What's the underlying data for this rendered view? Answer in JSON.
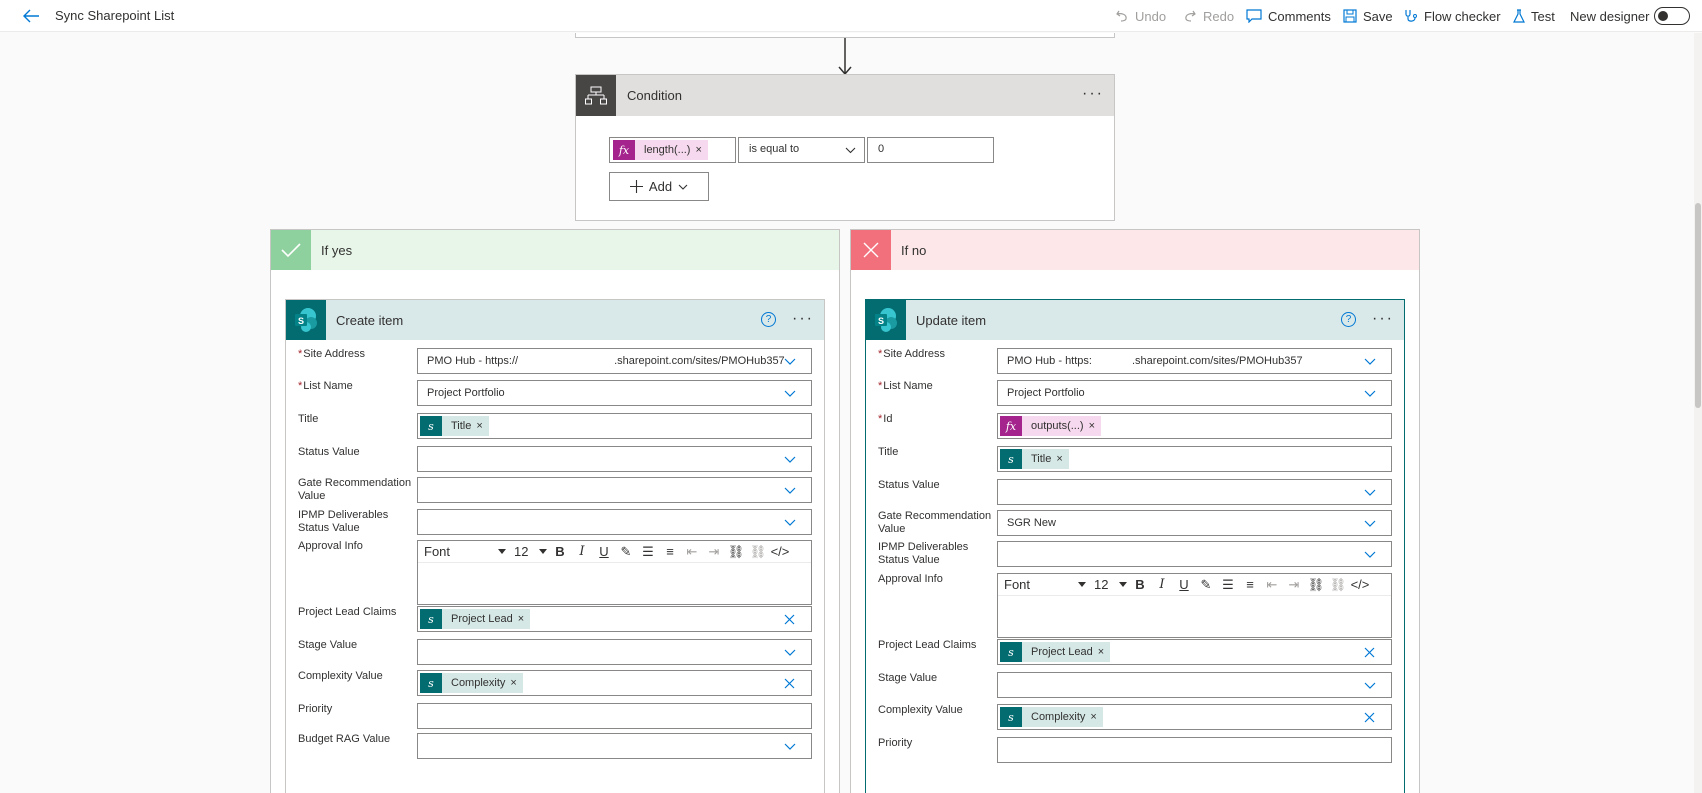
{
  "header": {
    "title": "Sync Sharepoint List",
    "commands": {
      "undo": "Undo",
      "redo": "Redo",
      "comments": "Comments",
      "save": "Save",
      "flow_checker": "Flow checker",
      "test": "Test",
      "new_designer": "New designer"
    }
  },
  "condition": {
    "title": "Condition",
    "left_operand": "length(...)",
    "operator": "is equal to",
    "right_operand": "0",
    "add_label": "Add"
  },
  "branch_yes": {
    "label": "If yes",
    "action": {
      "title": "Create item",
      "fields": {
        "site_address": {
          "label": "Site Address",
          "value_prefix": "PMO Hub - https://",
          "value_suffix": ".sharepoint.com/sites/PMOHub357"
        },
        "list_name": {
          "label": "List Name",
          "value": "Project Portfolio"
        },
        "title": {
          "label": "Title",
          "token": "Title"
        },
        "status_value": {
          "label": "Status Value",
          "value": ""
        },
        "gate_recommendation": {
          "label": "Gate Recommendation Value",
          "value": ""
        },
        "ipmp": {
          "label": "IPMP Deliverables Status Value",
          "value": ""
        },
        "approval_info": {
          "label": "Approval Info",
          "font": "Font",
          "size": "12"
        },
        "project_lead": {
          "label": "Project Lead Claims",
          "token": "Project Lead"
        },
        "stage_value": {
          "label": "Stage Value",
          "value": ""
        },
        "complexity": {
          "label": "Complexity Value",
          "token": "Complexity"
        },
        "priority": {
          "label": "Priority",
          "value": ""
        },
        "budget_rag": {
          "label": "Budget RAG Value",
          "value": ""
        }
      }
    }
  },
  "branch_no": {
    "label": "If no",
    "action": {
      "title": "Update item",
      "fields": {
        "site_address": {
          "label": "Site Address",
          "value_prefix": "PMO Hub - https:",
          "value_suffix": ".sharepoint.com/sites/PMOHub357"
        },
        "list_name": {
          "label": "List Name",
          "value": "Project Portfolio"
        },
        "id": {
          "label": "Id",
          "token": "outputs(...)"
        },
        "title": {
          "label": "Title",
          "token": "Title"
        },
        "status_value": {
          "label": "Status Value",
          "value": ""
        },
        "gate_recommendation": {
          "label": "Gate Recommendation Value",
          "value": "SGR New"
        },
        "ipmp": {
          "label": "IPMP Deliverables Status Value",
          "value": ""
        },
        "approval_info": {
          "label": "Approval Info",
          "font": "Font",
          "size": "12"
        },
        "project_lead": {
          "label": "Project Lead Claims",
          "token": "Project Lead"
        },
        "stage_value": {
          "label": "Stage Value",
          "value": ""
        },
        "complexity": {
          "label": "Complexity Value",
          "token": "Complexity"
        },
        "priority": {
          "label": "Priority",
          "value": ""
        }
      }
    }
  },
  "colors": {
    "accent": "#0078d4",
    "sharepoint": "#036c70",
    "expression": "#a4238c",
    "yes": "#8fd19e",
    "no": "#f1707b"
  }
}
